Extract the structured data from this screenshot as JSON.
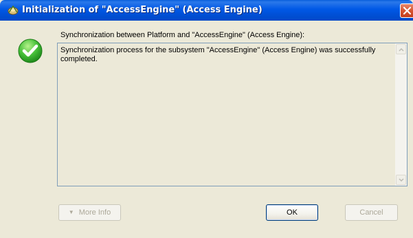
{
  "window": {
    "title": "Initialization of \"AccessEngine\" (Access Engine)",
    "close_icon": "close-icon",
    "title_icon": "app-icon"
  },
  "status": {
    "icon": "success-check-icon",
    "color": "#3cb72f"
  },
  "content": {
    "label": "Synchronization between Platform and \"AccessEngine\" (Access Engine):",
    "output_text": "Synchronization process for the subsystem \"AccessEngine\" (Access Engine) was successfully completed."
  },
  "buttons": {
    "more_info_label": "More Info",
    "more_info_icon": "expand-arrow-icon",
    "ok_label": "OK",
    "cancel_label": "Cancel"
  },
  "colors": {
    "titlebar": "#0058e6",
    "window_bg": "#ece9d8",
    "close_button": "#d7542f"
  }
}
